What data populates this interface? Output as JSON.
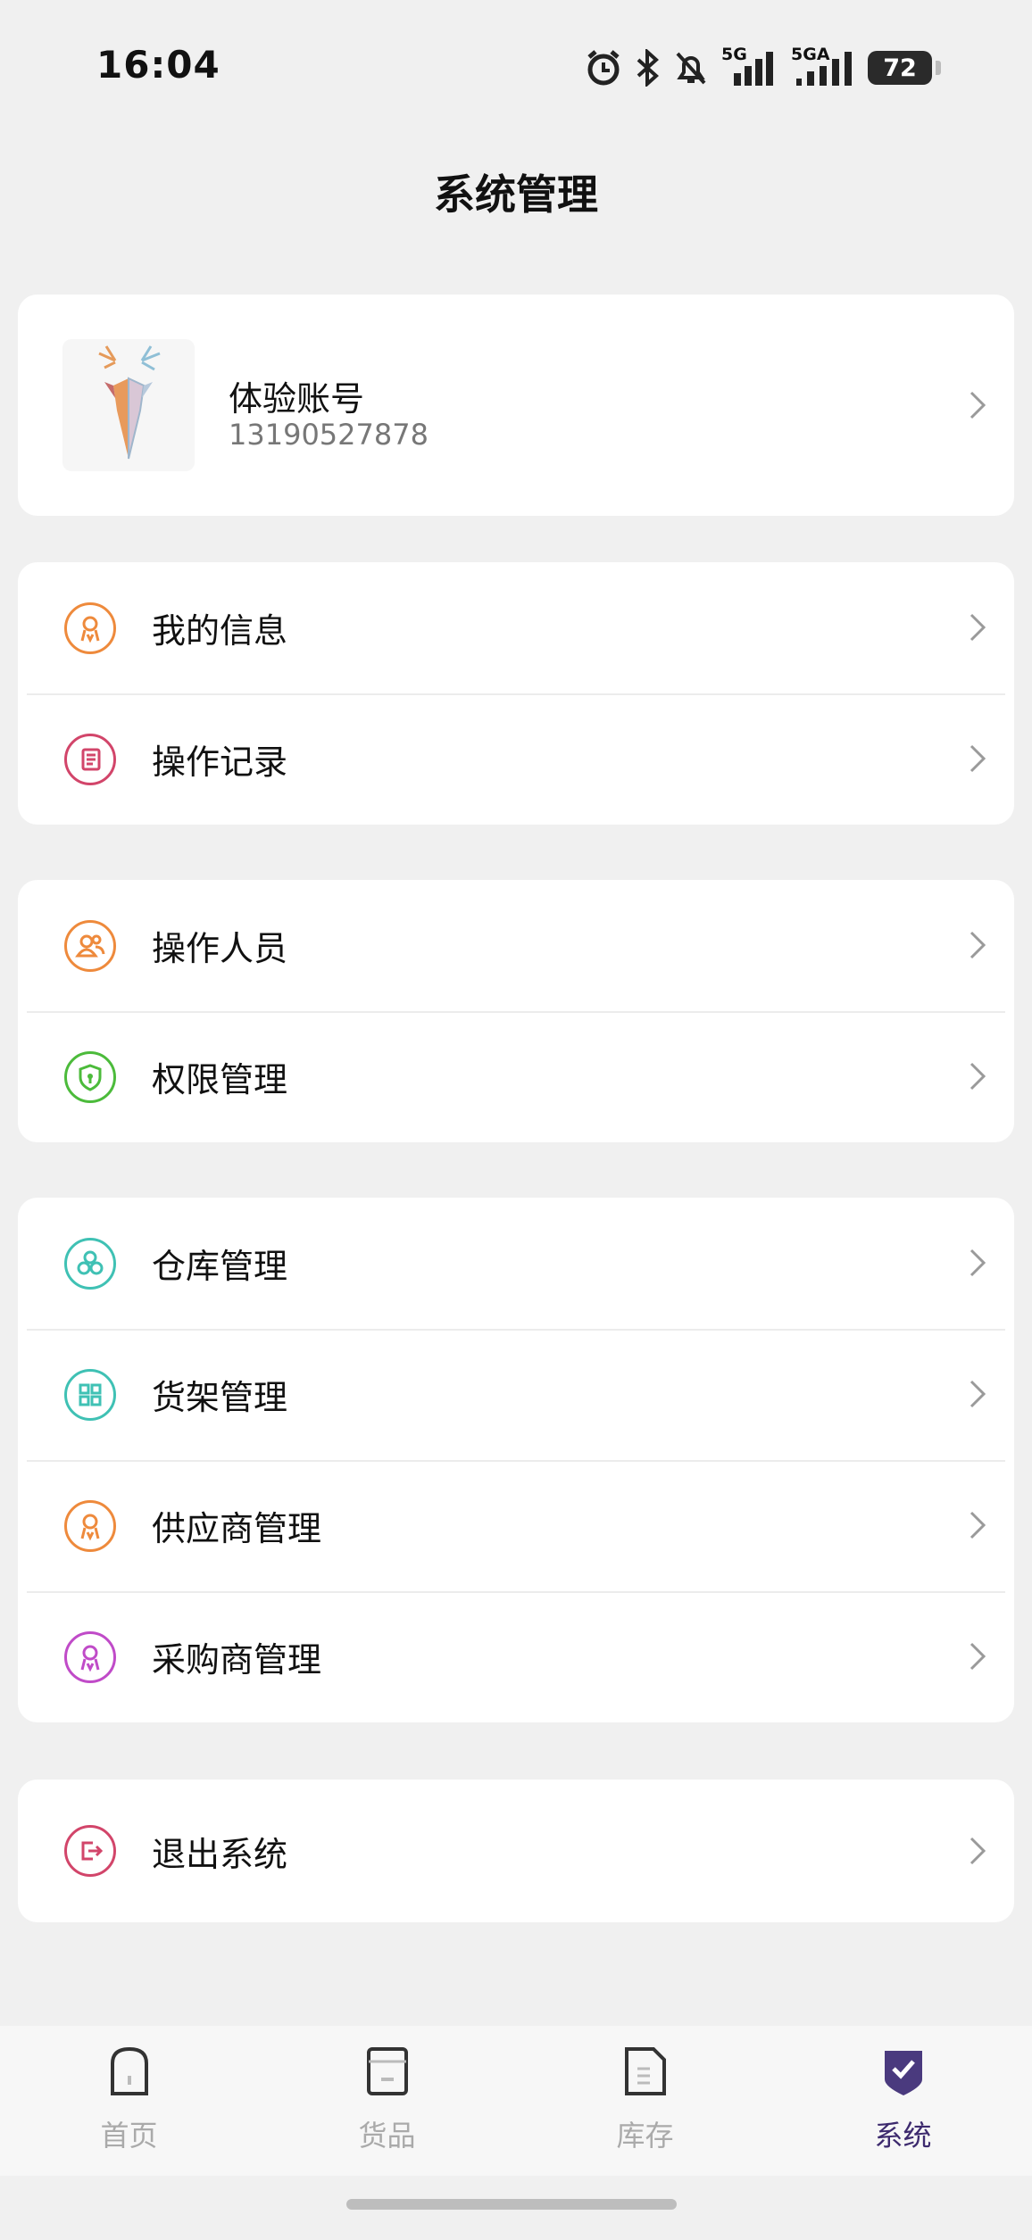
{
  "status_bar": {
    "time": "16:04",
    "signal1_label": "5G",
    "signal2_label": "5GA",
    "battery": "72",
    "icons": [
      "alarm-icon",
      "bluetooth-icon",
      "bell-off-icon",
      "signal-icon",
      "signal-icon",
      "battery-icon"
    ]
  },
  "header": {
    "title": "系统管理"
  },
  "profile": {
    "name": "体验账号",
    "phone": "13190527878",
    "avatar_icon": "deer-logo"
  },
  "menu_groups": [
    {
      "items": [
        {
          "label": "我的信息",
          "icon": "user-badge-icon",
          "color": "#ee8a3c"
        },
        {
          "label": "操作记录",
          "icon": "scroll-icon",
          "color": "#d2456a"
        }
      ]
    },
    {
      "items": [
        {
          "label": "操作人员",
          "icon": "users-icon",
          "color": "#ee8a3c"
        },
        {
          "label": "权限管理",
          "icon": "shield-icon",
          "color": "#4cbb3b"
        }
      ]
    },
    {
      "items": [
        {
          "label": "仓库管理",
          "icon": "cubes-icon",
          "color": "#3fc1b4"
        },
        {
          "label": "货架管理",
          "icon": "grid-icon",
          "color": "#3fc1b4"
        },
        {
          "label": "供应商管理",
          "icon": "user-badge-icon",
          "color": "#ee8a3c"
        },
        {
          "label": "采购商管理",
          "icon": "user-badge-icon",
          "color": "#c04bc8"
        }
      ]
    },
    {
      "items": [
        {
          "label": "退出系统",
          "icon": "logout-icon",
          "color": "#d2456a"
        }
      ]
    }
  ],
  "bottom_nav": {
    "active_color": "#3d2a6e",
    "inactive_color": "#aaaaaa",
    "items": [
      {
        "label": "首页",
        "icon": "home-icon",
        "active": false
      },
      {
        "label": "货品",
        "icon": "goods-icon",
        "active": false
      },
      {
        "label": "库存",
        "icon": "inventory-icon",
        "active": false
      },
      {
        "label": "系统",
        "icon": "system-check-icon",
        "active": true
      }
    ]
  }
}
